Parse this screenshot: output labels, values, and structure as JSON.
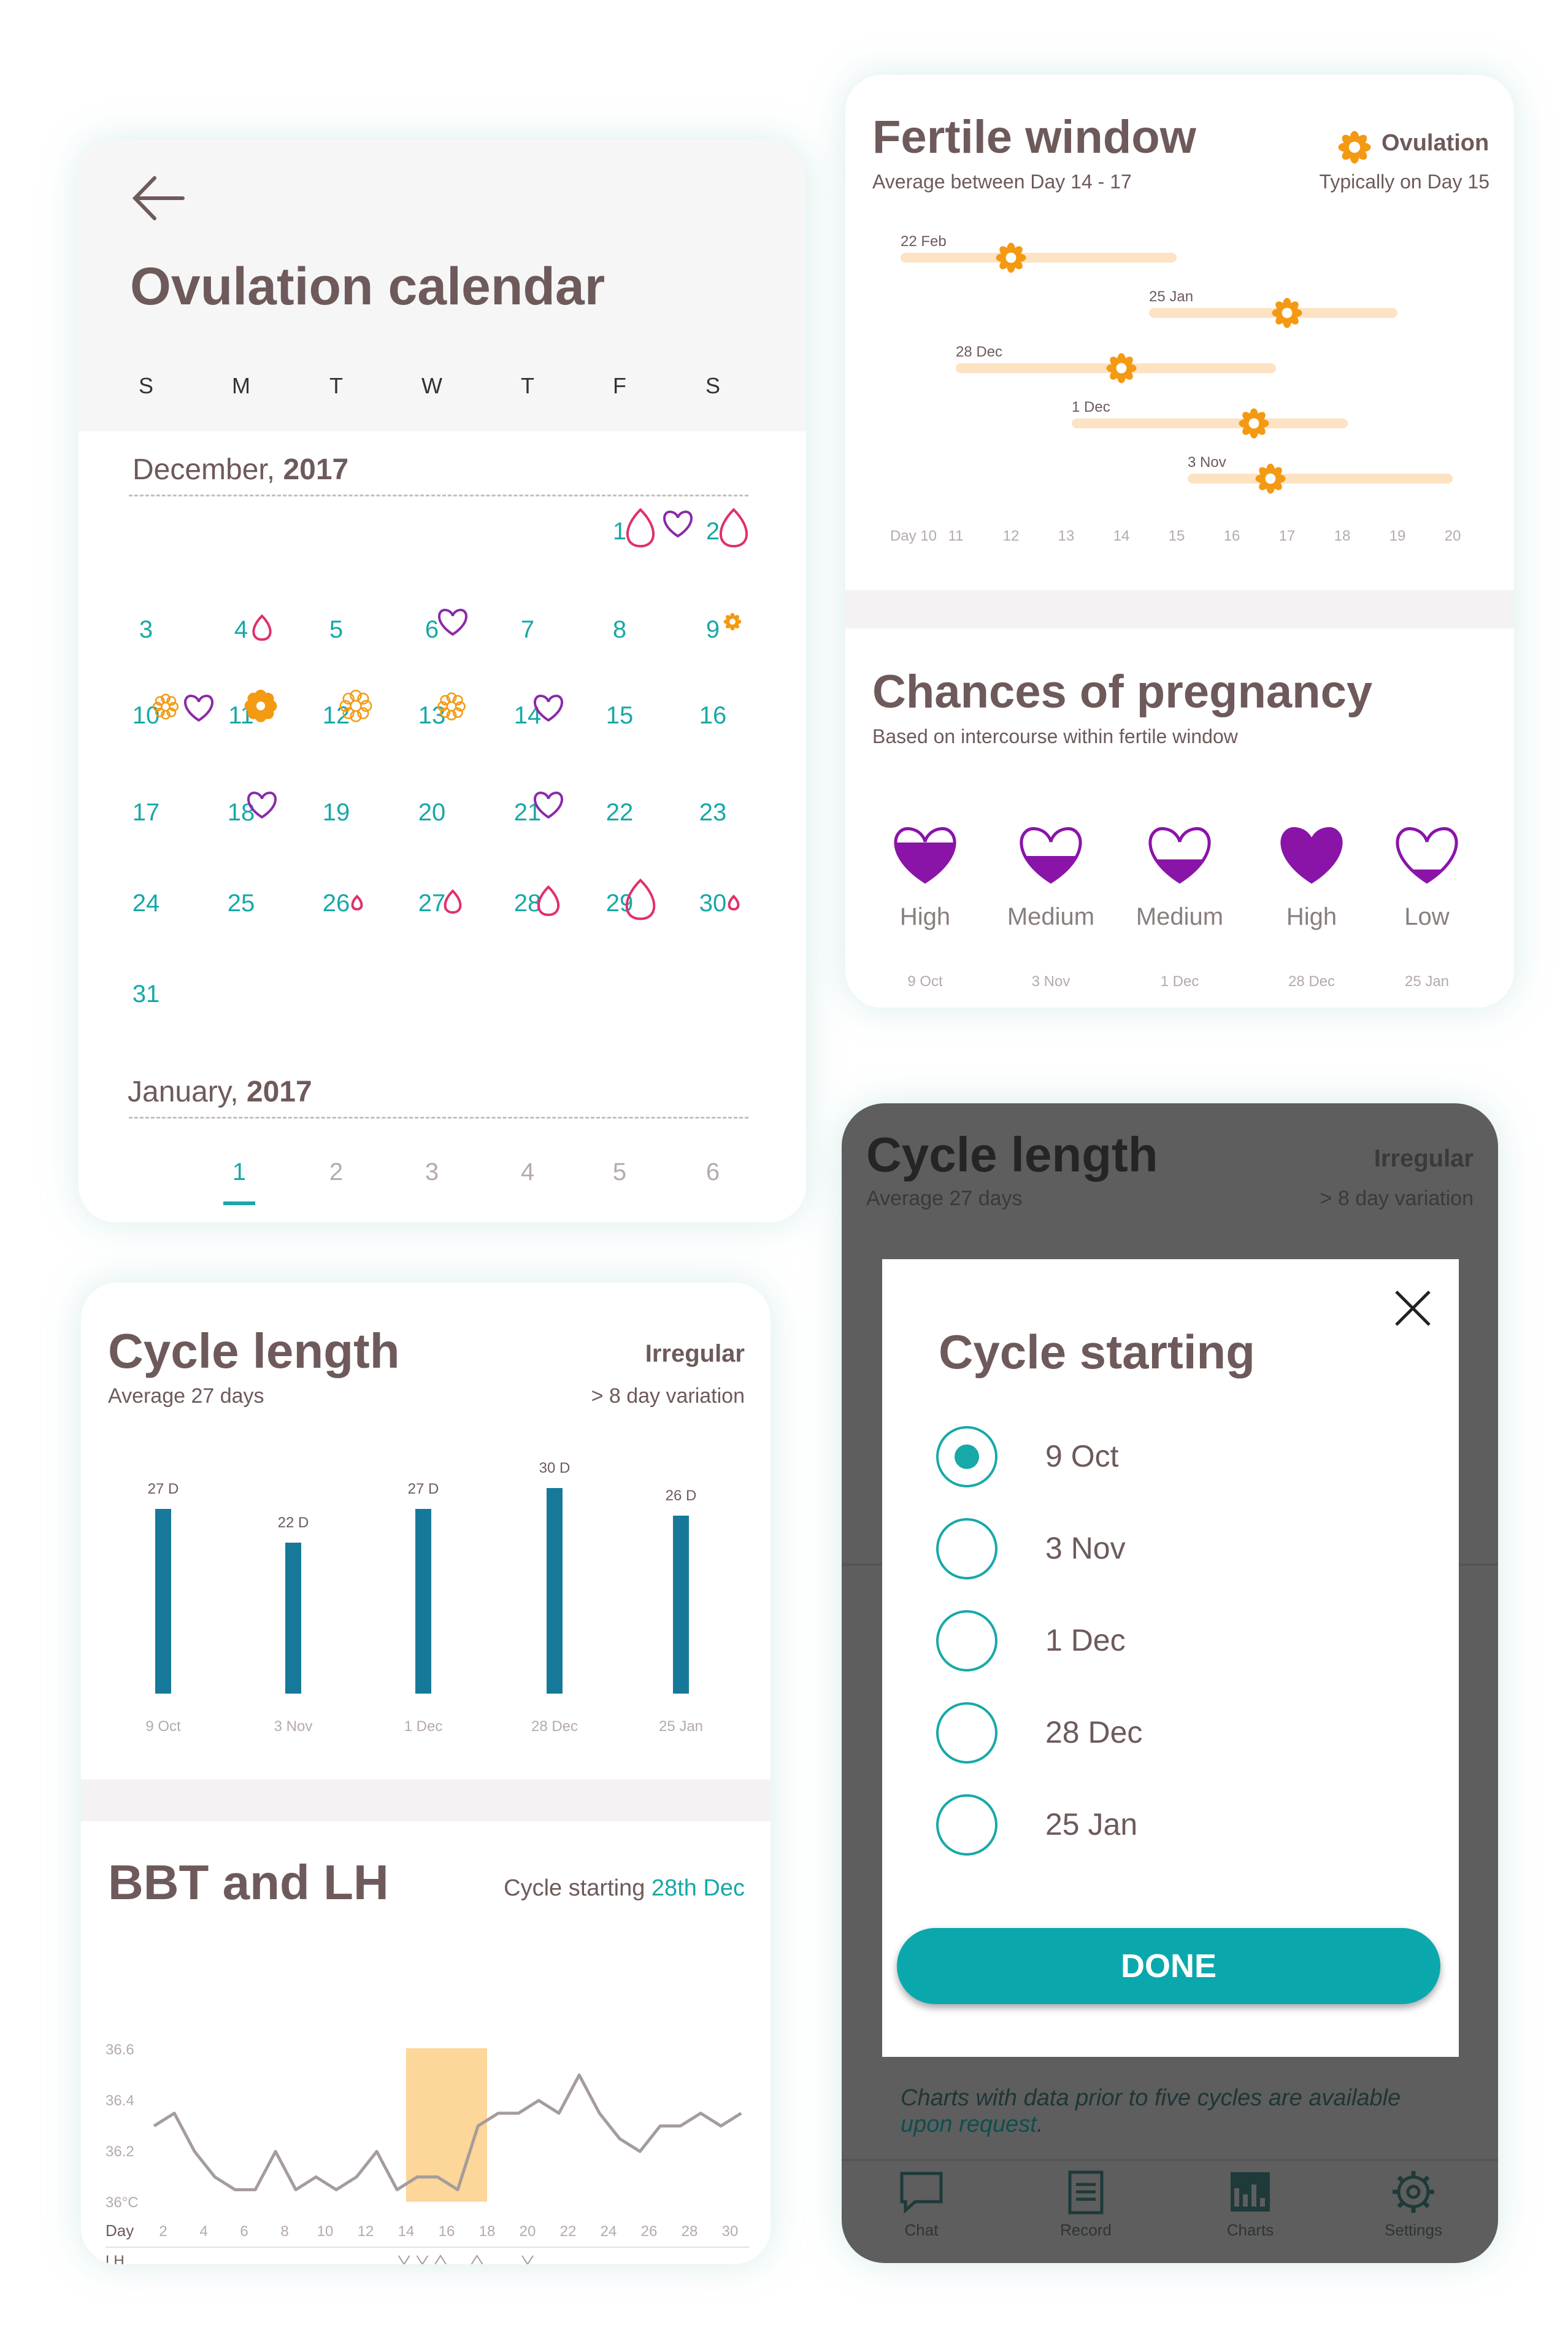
{
  "calendar": {
    "title": "Ovulation calendar",
    "weekdays": [
      "S",
      "M",
      "T",
      "W",
      "T",
      "F",
      "S"
    ],
    "month1": {
      "name": "December, ",
      "year": "2017"
    },
    "month2": {
      "name": "January, ",
      "year": "2017"
    },
    "days": [
      "1",
      "2",
      "3",
      "4",
      "5",
      "6",
      "7",
      "8",
      "9",
      "10",
      "11",
      "12",
      "13",
      "14",
      "15",
      "16",
      "17",
      "18",
      "19",
      "20",
      "21",
      "22",
      "23",
      "24",
      "25",
      "26",
      "27",
      "28",
      "29",
      "30",
      "31"
    ],
    "week_tabs": [
      "1",
      "2",
      "3",
      "4",
      "5",
      "6"
    ],
    "active_week_tab": "1",
    "colors": {
      "teal": "#17a8a8",
      "drop": "#e0306a",
      "heart": "#8a2aa8",
      "flower": "#f39a12"
    }
  },
  "fertile": {
    "title": "Fertile window",
    "subtitle": "Average between Day 14 - 17",
    "ovulation_label": "Ovulation",
    "ovulation_sub": "Typically on Day 15",
    "rows": [
      "22 Feb",
      "25 Jan",
      "28 Dec",
      "1 Dec",
      "3 Nov"
    ],
    "axis": [
      "Day 10",
      "11",
      "12",
      "13",
      "14",
      "15",
      "16",
      "17",
      "18",
      "19",
      "20"
    ]
  },
  "pregnancy": {
    "title": "Chances of pregnancy",
    "subtitle": "Based on intercourse within fertile window",
    "items": [
      {
        "level": "High",
        "date": "9 Oct",
        "fill": 0.7
      },
      {
        "level": "Medium",
        "date": "3 Nov",
        "fill": 0.5
      },
      {
        "level": "Medium",
        "date": "1 Dec",
        "fill": 0.45
      },
      {
        "level": "High",
        "date": "28 Dec",
        "fill": 1.0
      },
      {
        "level": "Low",
        "date": "25 Jan",
        "fill": 0.3
      }
    ]
  },
  "cycle": {
    "title": "Cycle length",
    "subtitle": "Average 27 days",
    "status": "Irregular",
    "variation": "> 8 day variation"
  },
  "bbt": {
    "title": "BBT and LH",
    "cycle_prefix": "Cycle starting ",
    "cycle_value": "28th Dec",
    "y_ticks": [
      "36.6",
      "36.4",
      "36.2",
      "36°C"
    ],
    "day_label": "Day",
    "lh_label": "LH",
    "x_ticks": [
      "2",
      "4",
      "6",
      "8",
      "10",
      "12",
      "14",
      "16",
      "18",
      "20",
      "22",
      "24",
      "26",
      "28",
      "30"
    ]
  },
  "dark_panel": {
    "title": "Cycle length",
    "subtitle": "Average 27 days",
    "status": "Irregular",
    "variation": "> 8 day variation",
    "footer_text": "Charts with data prior to five cycles are available",
    "footer_link": "upon request",
    "nav": [
      "Chat",
      "Record",
      "Charts",
      "Settings"
    ]
  },
  "dialog": {
    "title": "Cycle starting",
    "options": [
      "9 Oct",
      "3 Nov",
      "1 Dec",
      "28 Dec",
      "25 Jan"
    ],
    "selected": "9 Oct",
    "done_label": "DONE"
  },
  "chart_data": [
    {
      "type": "bar",
      "title": "Cycle length",
      "categories": [
        "9 Oct",
        "3 Nov",
        "1 Dec",
        "28 Dec",
        "25 Jan"
      ],
      "values": [
        27,
        22,
        27,
        30,
        26
      ],
      "value_labels": [
        "27 D",
        "22 D",
        "27 D",
        "30 D",
        "26 D"
      ],
      "ylim": [
        0,
        30
      ]
    },
    {
      "type": "line",
      "title": "BBT and LH",
      "x": [
        1,
        2,
        3,
        4,
        5,
        6,
        7,
        8,
        9,
        10,
        11,
        12,
        13,
        14,
        15,
        16,
        17,
        18,
        19,
        20,
        21,
        22,
        23,
        24,
        25,
        26,
        27,
        28,
        29,
        30
      ],
      "y": [
        36.3,
        36.35,
        36.2,
        36.1,
        36.05,
        36.05,
        36.2,
        36.05,
        36.1,
        36.05,
        36.1,
        36.2,
        36.05,
        36.1,
        36.1,
        36.05,
        36.3,
        36.35,
        36.35,
        36.4,
        36.35,
        36.5,
        36.35,
        36.25,
        36.2,
        36.3,
        36.3,
        36.35,
        36.3,
        36.35
      ],
      "highlight_x": [
        14,
        18
      ],
      "xlim": [
        1,
        30
      ],
      "ylim": [
        35.95,
        36.6
      ],
      "colors": {
        "line": "#a59c9c",
        "highlight": "#fdd699"
      }
    }
  ]
}
